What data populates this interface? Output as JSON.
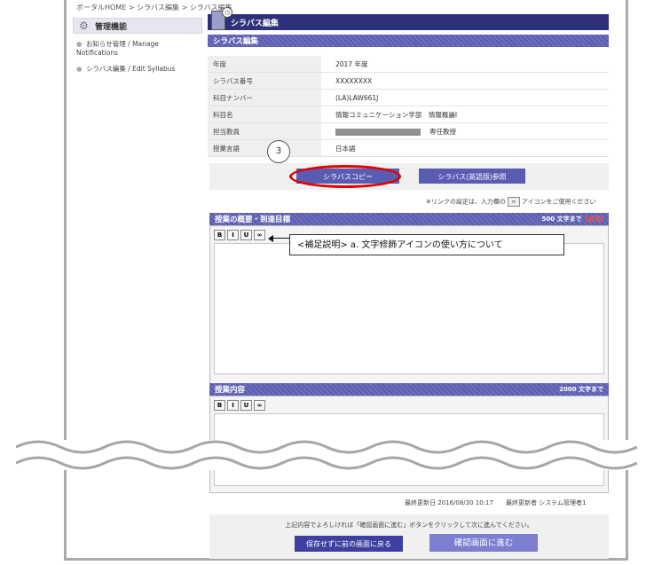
{
  "breadcrumb": "ポータルHOME > シラバス編集 > シラバス編集",
  "sidebar": {
    "title": "管理機能",
    "items": [
      {
        "label": "お知らせ管理 / Manage Notifications"
      },
      {
        "label": "シラバス編集 / Edit Syllabus"
      }
    ]
  },
  "header": {
    "title": "シラバス編集",
    "subtitle": "シラバス編集"
  },
  "info_rows": [
    {
      "key": "年度",
      "value": "2017 年度"
    },
    {
      "key": "シラバス番号",
      "value": "XXXXXXXX"
    },
    {
      "key": "科目ナンバー",
      "value": "(LA)LAW661J"
    },
    {
      "key": "科目名",
      "value": "情報コミュニケーション学部　情報概論I"
    },
    {
      "key": "担当教員",
      "value": "専任教授"
    },
    {
      "key": "授業言語",
      "value": "日本語"
    }
  ],
  "step_marker": "3",
  "buttons": {
    "copy": "シラバスコピー",
    "english": "シラバス(英語版)参照",
    "back": "保存せずに前の画面に戻る",
    "next": "確認画面に進む"
  },
  "link_note": {
    "before": "※リンクの設定は、入力欄の",
    "after": "アイコンをご使用ください"
  },
  "sections": {
    "overview": {
      "title": "授業の概要・到達目標",
      "limit": "500 文字まで",
      "required": "[必須]"
    },
    "content": {
      "title": "授業内容",
      "limit": "2000 文字まで"
    }
  },
  "toolbar": {
    "bold": "B",
    "italic": "I",
    "underline": "U",
    "link": "∞"
  },
  "callout": "<補足説明> a. 文字修飾アイコンの使い方について",
  "update_info": "最終更新日 2016/08/30 10:17　　最終更新者 システム管理者1",
  "footer_message": "上記内容でよろしければ「確認画面に進む」ボタンをクリックして次に進んでください。"
}
